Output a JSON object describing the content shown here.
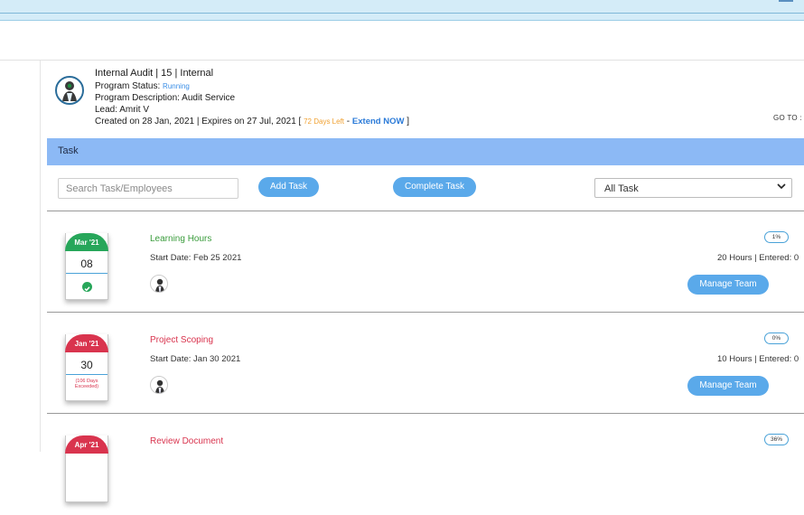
{
  "program": {
    "title": "Internal Audit | 15 | Internal",
    "status_label": "Program Status:",
    "status_value": "Running",
    "description": "Program Description: Audit Service",
    "lead": "Lead: Amrit V",
    "created": "Created on 28 Jan, 2021 | Expires on 27 Jul, 2021 [",
    "days_left": "72 Days Left",
    "dash": " - ",
    "extend": "Extend NOW",
    "bracket_close": " ]",
    "goto": "GO TO :"
  },
  "task_section": {
    "title": "Task",
    "search_placeholder": "Search Task/Employees",
    "add_label": "Add Task",
    "complete_label": "Complete Task",
    "filter_selected": "All Task"
  },
  "tasks": [
    {
      "month": "Mar '21",
      "day": "08",
      "status": "completed",
      "name": "Learning Hours",
      "start_date": "Start Date: Feb 25 2021",
      "hours": "20 Hours | Entered: 0",
      "progress": "1%",
      "manage_label": "Manage Team",
      "color": "#27a65a",
      "exceeded": ""
    },
    {
      "month": "Jan '21",
      "day": "30",
      "status": "overdue",
      "name": "Project Scoping",
      "start_date": "Start Date: Jan 30 2021",
      "hours": "10 Hours | Entered: 0",
      "progress": "0%",
      "manage_label": "Manage Team",
      "color": "#d9344e",
      "exceeded": "(106 Days Exceeded)"
    },
    {
      "month": "Apr '21",
      "day": "",
      "status": "overdue",
      "name": "Review Document",
      "start_date": "",
      "hours": "",
      "progress": "36%",
      "manage_label": "",
      "color": "#d9344e",
      "exceeded": ""
    }
  ],
  "colors": {
    "accent": "#5aa9ea",
    "task_header": "#8cb9f5",
    "completed": "#27a65a",
    "overdue": "#d9344e",
    "warning": "#f0a030"
  }
}
